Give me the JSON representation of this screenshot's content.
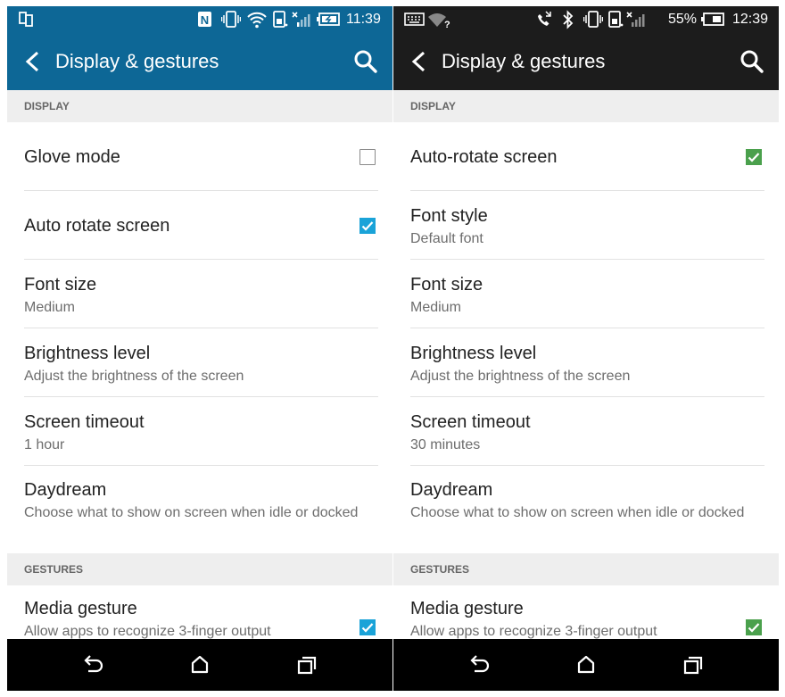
{
  "phones": [
    {
      "status_bar": {
        "time": "11:39",
        "battery_percent": ""
      },
      "app_bar": {
        "title": "Display & gestures"
      },
      "sections": [
        {
          "header": "DISPLAY",
          "rows": [
            {
              "title": "Glove mode",
              "subtitle": "",
              "checkbox": "unchecked"
            },
            {
              "title": "Auto rotate screen",
              "subtitle": "",
              "checkbox": "checked"
            },
            {
              "title": "Font size",
              "subtitle": "Medium"
            },
            {
              "title": "Brightness level",
              "subtitle": "Adjust the brightness of the screen"
            },
            {
              "title": "Screen timeout",
              "subtitle": "1 hour"
            },
            {
              "title": "Daydream",
              "subtitle": "Choose what to show on screen when idle or docked"
            }
          ]
        },
        {
          "header": "GESTURES",
          "rows": [
            {
              "title": "Media gesture",
              "subtitle": "Allow apps to recognize 3-finger output",
              "checkbox": "checked"
            }
          ]
        }
      ],
      "colors": {
        "app_bar": "#0d6796",
        "checkbox_checked": "#1aa3d8"
      },
      "icons": [
        "nfc-icon",
        "vibrate-icon",
        "wifi-icon",
        "sim-icon",
        "signal-icon",
        "battery-charging-icon",
        "back-arrow-icon",
        "search-icon",
        "nav-back-icon",
        "nav-home-icon",
        "nav-recents-icon"
      ]
    },
    {
      "status_bar": {
        "time": "12:39",
        "battery_percent": "55%"
      },
      "app_bar": {
        "title": "Display & gestures"
      },
      "sections": [
        {
          "header": "DISPLAY",
          "rows": [
            {
              "title": "Auto-rotate screen",
              "subtitle": "",
              "checkbox": "checked"
            },
            {
              "title": "Font style",
              "subtitle": "Default font"
            },
            {
              "title": "Font size",
              "subtitle": "Medium"
            },
            {
              "title": "Brightness level",
              "subtitle": "Adjust the brightness of the screen"
            },
            {
              "title": "Screen timeout",
              "subtitle": "30 minutes"
            },
            {
              "title": "Daydream",
              "subtitle": "Choose what to show on screen when idle or docked"
            }
          ]
        },
        {
          "header": "GESTURES",
          "rows": [
            {
              "title": "Media gesture",
              "subtitle": "Allow apps to recognize 3-finger output",
              "checkbox": "checked"
            }
          ]
        }
      ],
      "colors": {
        "app_bar": "#1c1c1c",
        "checkbox_checked": "#4aa04c"
      },
      "icons": [
        "keyboard-icon",
        "wifi-unknown-icon",
        "missed-call-icon",
        "bluetooth-icon",
        "vibrate-icon",
        "sim-icon",
        "signal-icon",
        "battery-icon",
        "back-arrow-icon",
        "search-icon",
        "nav-back-icon",
        "nav-home-icon",
        "nav-recents-icon"
      ]
    }
  ]
}
